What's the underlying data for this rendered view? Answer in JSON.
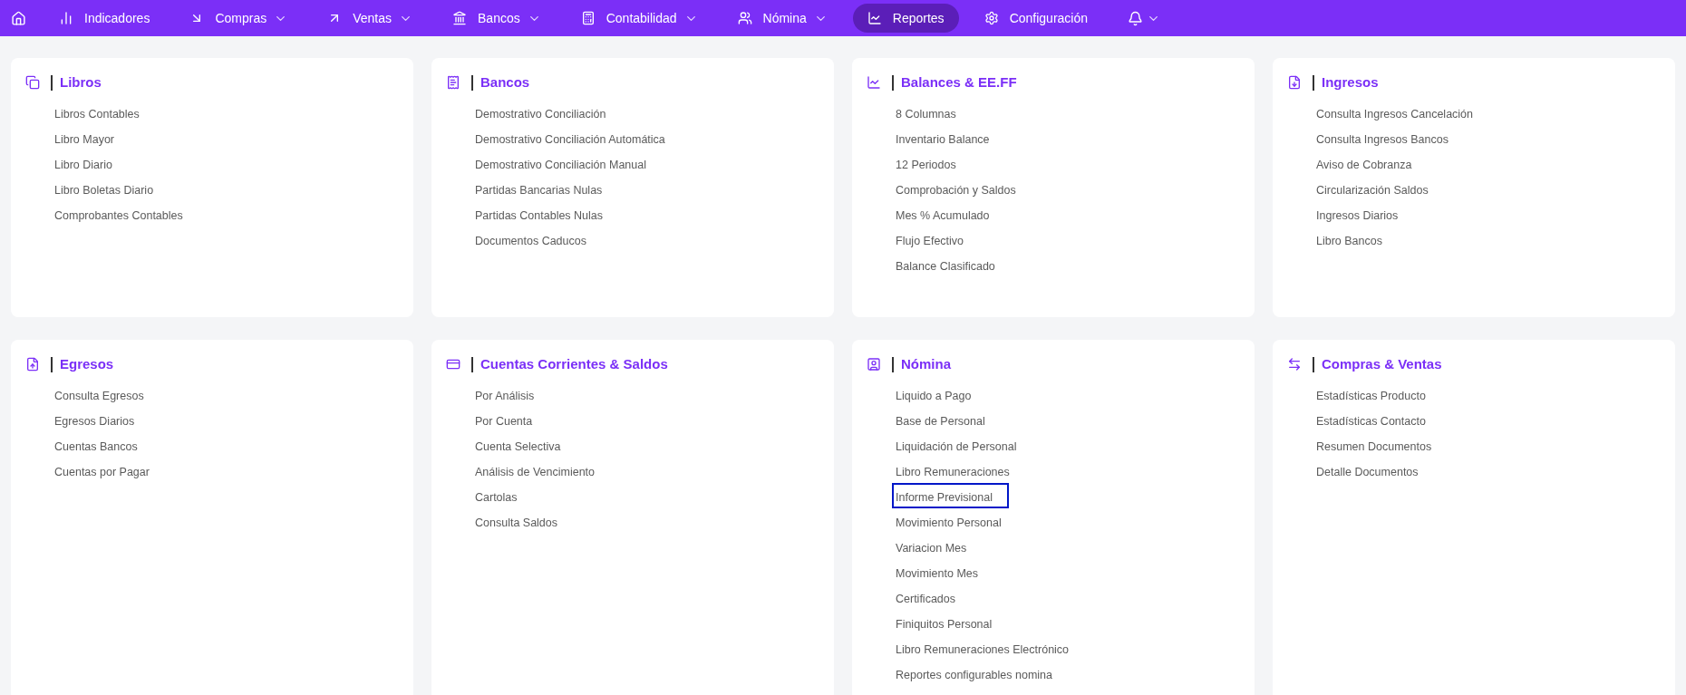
{
  "nav": {
    "items": [
      {
        "label": "Indicadores",
        "has_menu": false,
        "selected": false
      },
      {
        "label": "Compras",
        "has_menu": true,
        "selected": false
      },
      {
        "label": "Ventas",
        "has_menu": true,
        "selected": false
      },
      {
        "label": "Bancos",
        "has_menu": true,
        "selected": false
      },
      {
        "label": "Contabilidad",
        "has_menu": true,
        "selected": false
      },
      {
        "label": "Nómina",
        "has_menu": true,
        "selected": false
      },
      {
        "label": "Reportes",
        "has_menu": false,
        "selected": true
      },
      {
        "label": "Configuración",
        "has_menu": false,
        "selected": false
      }
    ],
    "notifications": {
      "has_menu": true
    }
  },
  "sections": [
    {
      "title": "Libros",
      "items": [
        {
          "label": "Libros Contables",
          "selected": false
        },
        {
          "label": "Libro Mayor",
          "selected": false
        },
        {
          "label": "Libro Diario",
          "selected": false
        },
        {
          "label": "Libro Boletas Diario",
          "selected": false
        },
        {
          "label": "Comprobantes Contables",
          "selected": false
        }
      ]
    },
    {
      "title": "Bancos",
      "items": [
        {
          "label": "Demostrativo Conciliación",
          "selected": false
        },
        {
          "label": "Demostrativo Conciliación Automática",
          "selected": false
        },
        {
          "label": "Demostrativo Conciliación Manual",
          "selected": false
        },
        {
          "label": "Partidas Bancarias Nulas",
          "selected": false
        },
        {
          "label": "Partidas Contables Nulas",
          "selected": false
        },
        {
          "label": "Documentos Caducos",
          "selected": false
        }
      ]
    },
    {
      "title": "Balances & EE.FF",
      "items": [
        {
          "label": "8 Columnas",
          "selected": false
        },
        {
          "label": "Inventario Balance",
          "selected": false
        },
        {
          "label": "12 Periodos",
          "selected": false
        },
        {
          "label": "Comprobación y Saldos",
          "selected": false
        },
        {
          "label": "Mes % Acumulado",
          "selected": false
        },
        {
          "label": "Flujo Efectivo",
          "selected": false
        },
        {
          "label": "Balance Clasificado",
          "selected": false
        }
      ]
    },
    {
      "title": "Ingresos",
      "items": [
        {
          "label": "Consulta Ingresos Cancelación",
          "selected": false
        },
        {
          "label": "Consulta Ingresos Bancos",
          "selected": false
        },
        {
          "label": "Aviso de Cobranza",
          "selected": false
        },
        {
          "label": "Circularización Saldos",
          "selected": false
        },
        {
          "label": "Ingresos Diarios",
          "selected": false
        },
        {
          "label": "Libro Bancos",
          "selected": false
        }
      ]
    },
    {
      "title": "Egresos",
      "items": [
        {
          "label": "Consulta Egresos",
          "selected": false
        },
        {
          "label": "Egresos Diarios",
          "selected": false
        },
        {
          "label": "Cuentas Bancos",
          "selected": false
        },
        {
          "label": "Cuentas por Pagar",
          "selected": false
        }
      ]
    },
    {
      "title": "Cuentas Corrientes & Saldos",
      "items": [
        {
          "label": "Por Análisis",
          "selected": false
        },
        {
          "label": "Por Cuenta",
          "selected": false
        },
        {
          "label": "Cuenta Selectiva",
          "selected": false
        },
        {
          "label": "Análisis de Vencimiento",
          "selected": false
        },
        {
          "label": "Cartolas",
          "selected": false
        },
        {
          "label": "Consulta Saldos",
          "selected": false
        }
      ]
    },
    {
      "title": "Nómina",
      "items": [
        {
          "label": "Liquido a Pago",
          "selected": false
        },
        {
          "label": "Base de Personal",
          "selected": false
        },
        {
          "label": "Liquidación de Personal",
          "selected": false
        },
        {
          "label": "Libro Remuneraciones",
          "selected": false
        },
        {
          "label": "Informe Previsional",
          "selected": true
        },
        {
          "label": "Movimiento Personal",
          "selected": false
        },
        {
          "label": "Variacion Mes",
          "selected": false
        },
        {
          "label": "Movimiento Mes",
          "selected": false
        },
        {
          "label": "Certificados",
          "selected": false
        },
        {
          "label": "Finiquitos Personal",
          "selected": false
        },
        {
          "label": "Libro Remuneraciones Electrónico",
          "selected": false
        },
        {
          "label": "Reportes configurables nomina",
          "selected": false
        }
      ]
    },
    {
      "title": "Compras & Ventas",
      "items": [
        {
          "label": "Estadísticas Producto",
          "selected": false
        },
        {
          "label": "Estadísticas Contacto",
          "selected": false
        },
        {
          "label": "Resumen Documentos",
          "selected": false
        },
        {
          "label": "Detalle Documentos",
          "selected": false
        }
      ]
    }
  ]
}
